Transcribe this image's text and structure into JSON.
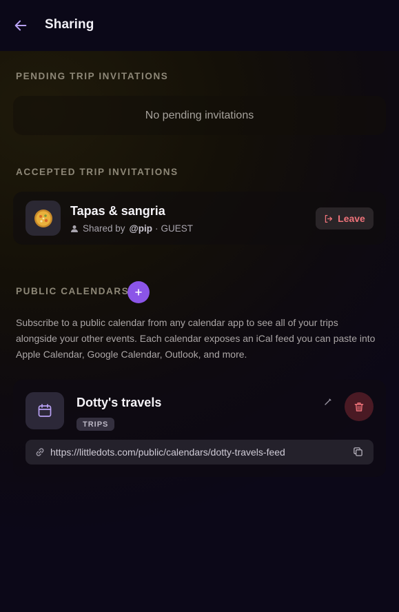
{
  "header": {
    "title": "Sharing"
  },
  "pending": {
    "label": "PENDING TRIP INVITATIONS",
    "empty_text": "No pending invitations"
  },
  "accepted": {
    "label": "ACCEPTED TRIP INVITATIONS",
    "items": [
      {
        "title": "Tapas & sangria",
        "shared_by_prefix": "Shared by",
        "handle": "@pip",
        "separator": "·",
        "role": "GUEST",
        "action_label": "Leave",
        "avatar_icon": "paella-icon"
      }
    ]
  },
  "calendars": {
    "label": "PUBLIC CALENDARS",
    "description": "Subscribe to a public calendar from any calendar app to see all of your trips alongside your other events. Each calendar exposes an iCal feed you can paste into Apple Calendar, Google Calendar, Outlook, and more.",
    "items": [
      {
        "title": "Dotty's travels",
        "badge": "TRIPS",
        "feed_url": "https://littledots.com/public/calendars/dotty-travels-feed"
      }
    ]
  },
  "colors": {
    "accent": "#8b55e8",
    "danger": "#f0737a",
    "background": "#0b0818"
  }
}
